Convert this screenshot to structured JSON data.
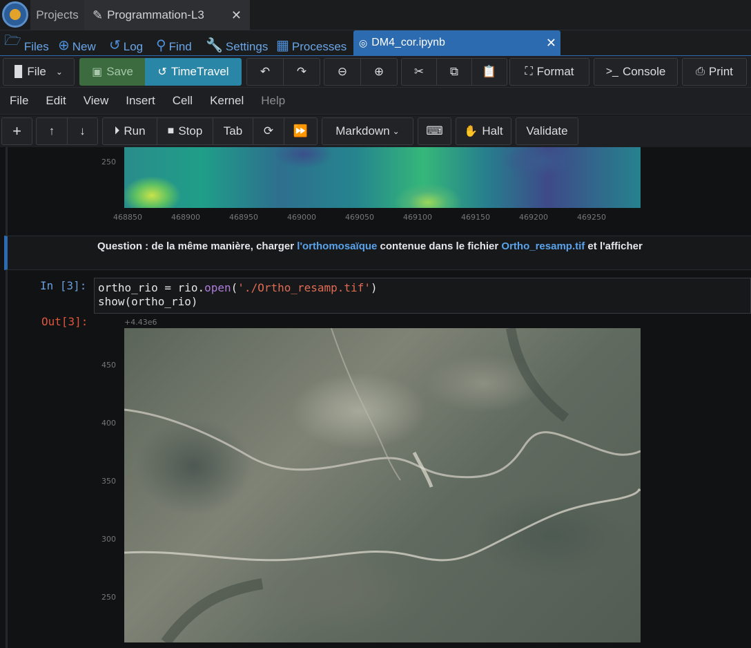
{
  "top_tabs": {
    "projects": "Projects",
    "project_tab": "Programmation-L3"
  },
  "action_bar": {
    "files": "Files",
    "new": "New",
    "log": "Log",
    "find": "Find",
    "settings": "Settings",
    "processes": "Processes",
    "open_file": "DM4_cor.ipynb"
  },
  "toolbar": {
    "file": "File",
    "save": "Save",
    "timetravel": "TimeTravel",
    "format": "Format",
    "console": "Console",
    "print": "Print"
  },
  "menu": [
    "File",
    "Edit",
    "View",
    "Insert",
    "Cell",
    "Kernel",
    "Help"
  ],
  "cell_toolbar": {
    "run": "Run",
    "stop": "Stop",
    "tab": "Tab",
    "cell_type": "Markdown",
    "halt": "Halt",
    "validate": "Validate"
  },
  "plot1": {
    "y_tick": "250",
    "x_ticks": [
      "468850",
      "468900",
      "468950",
      "469000",
      "469050",
      "469100",
      "469150",
      "469200",
      "469250"
    ]
  },
  "markdown": {
    "part1": "Question : de la même manière, charger ",
    "link1": "l'orthomosaïque",
    "part2": " contenue dans le fichier ",
    "link2": "Ortho_resamp.tif",
    "part3": " et l'afficher"
  },
  "code_cell": {
    "in_prompt": "In [3]:",
    "line1_a": "ortho_rio = rio.",
    "line1_fn": "open",
    "line1_b": "(",
    "line1_str": "'./Ortho_resamp.tif'",
    "line1_c": ")",
    "line2": "show(ortho_rio)",
    "out_prompt": "Out[3]:"
  },
  "plot2": {
    "offset_label": "+4.43e6",
    "y_ticks": [
      "450",
      "400",
      "350",
      "300",
      "250"
    ]
  }
}
